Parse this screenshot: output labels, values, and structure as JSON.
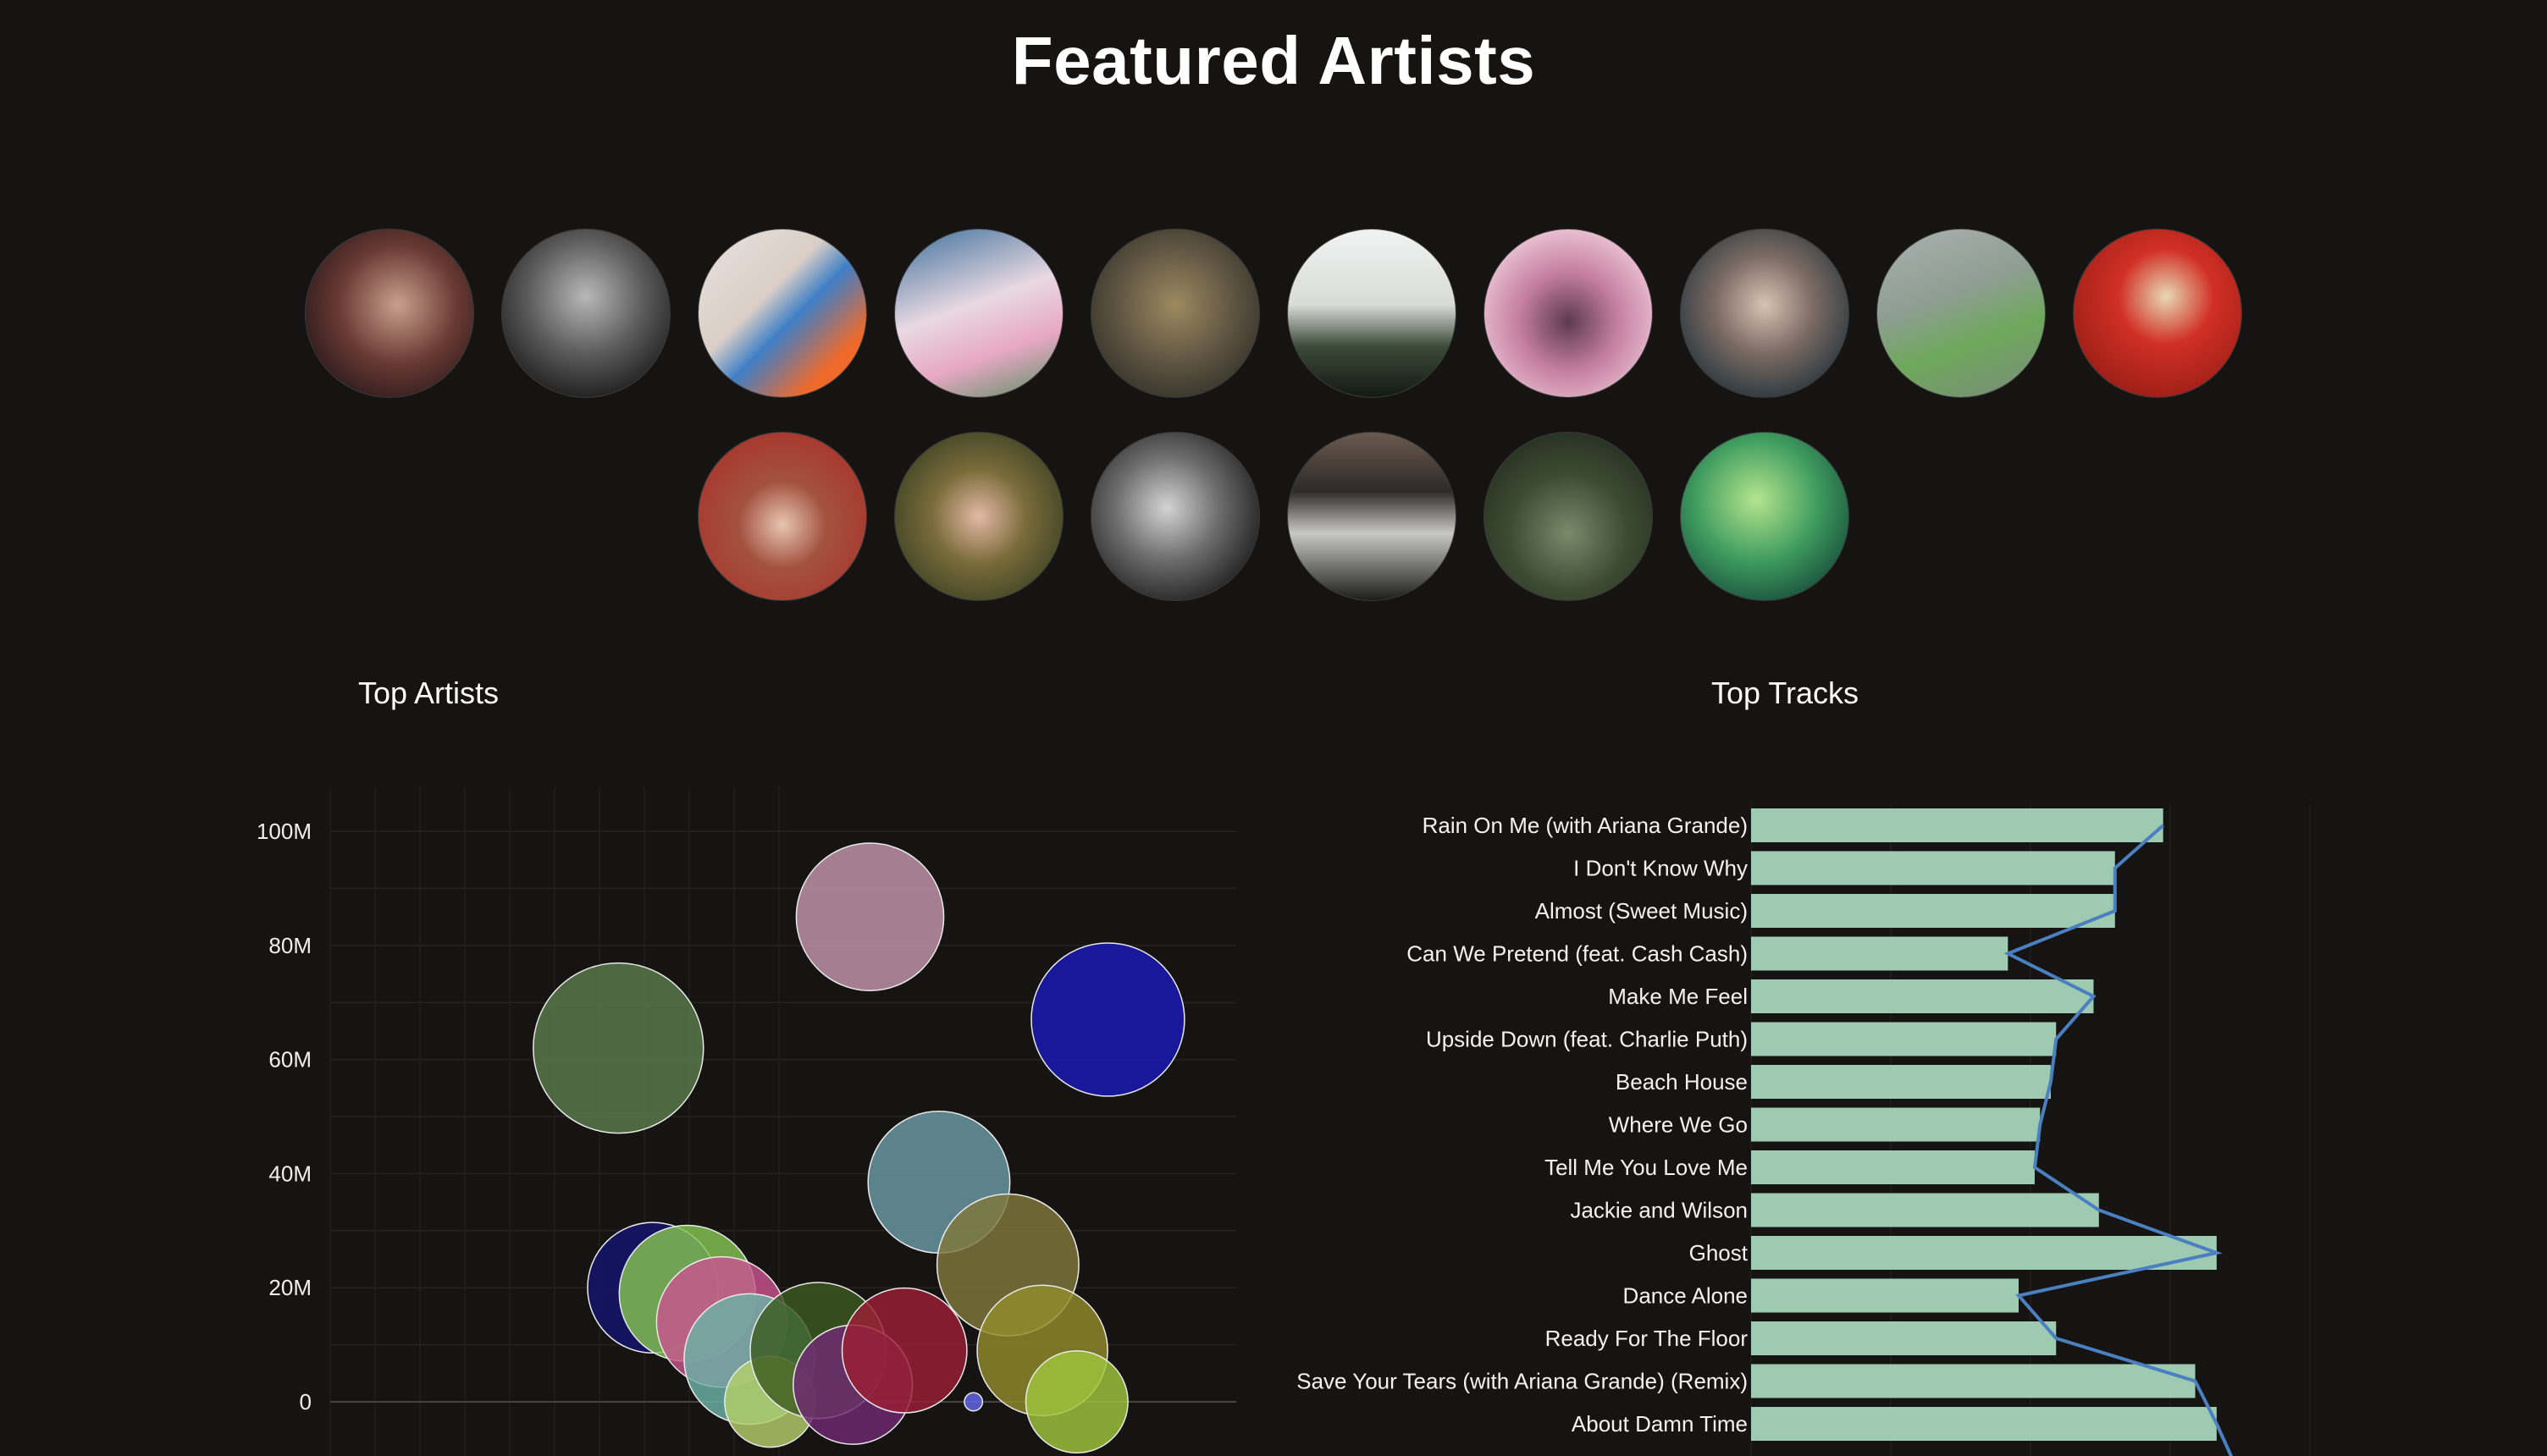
{
  "header": {
    "title": "Featured Artists"
  },
  "avatars": [
    {
      "name": "avatar-1",
      "bg": "radial-gradient(circle at 55% 45%, #c9a08e 0%, #6a3a33 45%, #2b1a1c 80%)"
    },
    {
      "name": "avatar-2",
      "bg": "radial-gradient(circle at 50% 40%, #b8b8b8 0%, #5a5a5a 45%, #161616 85%)"
    },
    {
      "name": "avatar-3",
      "bg": "linear-gradient(135deg, #e8e2dc 0%, #d9cfc7 40%, #3f7fc6 55%, #ef6a2a 80%)"
    },
    {
      "name": "avatar-4",
      "bg": "linear-gradient(160deg, #3c6f9c 0%, #e9d9e2 45%, #e8a9c6 70%, #5b8e61 100%)"
    },
    {
      "name": "avatar-5",
      "bg": "radial-gradient(circle at 50% 45%, #9e8a60 0%, #5a5140 50%, #2b2a22 90%)"
    },
    {
      "name": "avatar-6",
      "bg": "linear-gradient(180deg, #f1f2f2 0%, #d9dbd8 45%, #3b4a38 70%, #141a13 100%)"
    },
    {
      "name": "avatar-7",
      "bg": "radial-gradient(circle at 50% 55%, #5d3a4f 0%, #c57fa1 40%, #efc9da 80%)"
    },
    {
      "name": "avatar-8",
      "bg": "radial-gradient(circle at 50% 45%, #d8c2b5 0%, #7a6a62 40%, #1d2f3a 85%)"
    },
    {
      "name": "avatar-9",
      "bg": "linear-gradient(160deg, #aab0b2 0%, #8e9e92 40%, #6ea85b 65%, #7b8a7d 100%)"
    },
    {
      "name": "avatar-10",
      "bg": "radial-gradient(circle at 55% 40%, #e7d9b5 0%, #d12f24 35%, #8c1a13 90%)"
    },
    {
      "name": "avatar-11",
      "bg": "radial-gradient(circle at 50% 55%, #e7c6b0 0%, #a35240 35%, #a8352c 80%)"
    },
    {
      "name": "avatar-12",
      "bg": "radial-gradient(circle at 50% 50%, #e3b9a4 0%, #7a6b3a 40%, #2f3a1f 90%)"
    },
    {
      "name": "avatar-13",
      "bg": "radial-gradient(circle at 45% 45%, #d4d4d4 0%, #6d6d6d 40%, #121212 85%)"
    },
    {
      "name": "avatar-14",
      "bg": "linear-gradient(180deg, #6b5a4e 0%, #2d2a28 35%, #c8c8c4 60%, #1c1c1c 100%)"
    },
    {
      "name": "avatar-15",
      "bg": "radial-gradient(circle at 50% 60%, #7a8a6a 0%, #3d4b33 45%, #1f2a1b 90%)"
    },
    {
      "name": "avatar-16",
      "bg": "radial-gradient(circle at 45% 40%, #b5e58e 0%, #3f9c5f 45%, #0f3b34 90%)"
    }
  ],
  "charts": {
    "artists_title": "Top Artists",
    "tracks_title": "Top Tracks"
  },
  "chart_data": [
    {
      "type": "scatter",
      "title": "Top Artists",
      "y_ticks": [
        "0",
        "20M",
        "40M",
        "60M",
        "80M",
        "100M"
      ],
      "ylim": [
        -7000000,
        107000000
      ],
      "xlim": [
        0,
        21
      ],
      "grid": true,
      "series": [
        {
          "x": 10.5,
          "y": 85000000,
          "size": 13,
          "color": "#c497ad"
        },
        {
          "x": 3.2,
          "y": 62000000,
          "size": 15,
          "color": "#5a7d4c"
        },
        {
          "x": 17.4,
          "y": 67000000,
          "size": 13.5,
          "color": "#1a18b8"
        },
        {
          "x": 12.5,
          "y": 38500000,
          "size": 12.5,
          "color": "#6b9ba6"
        },
        {
          "x": 4.2,
          "y": 20000000,
          "size": 11.5,
          "color": "#14136e"
        },
        {
          "x": 5.2,
          "y": 19000000,
          "size": 12,
          "color": "#85c452"
        },
        {
          "x": 6.2,
          "y": 14000000,
          "size": 11.5,
          "color": "#c9538f"
        },
        {
          "x": 7.0,
          "y": 7500000,
          "size": 11.5,
          "color": "#6bb2a6"
        },
        {
          "x": 7.6,
          "y": 0,
          "size": 8,
          "color": "#b5d06a"
        },
        {
          "x": 9.0,
          "y": 9000000,
          "size": 12,
          "color": "#3c5a1f"
        },
        {
          "x": 10.0,
          "y": 3000000,
          "size": 10.5,
          "color": "#702a73"
        },
        {
          "x": 11.5,
          "y": 9000000,
          "size": 11,
          "color": "#9b1f34"
        },
        {
          "x": 14.5,
          "y": 24000000,
          "size": 12.5,
          "color": "#80783a"
        },
        {
          "x": 15.5,
          "y": 9000000,
          "size": 11.5,
          "color": "#918c2c"
        },
        {
          "x": 16.5,
          "y": 0,
          "size": 9,
          "color": "#9fc63c"
        },
        {
          "x": 13.5,
          "y": 0,
          "size": 1.6,
          "color": "#6666ee"
        }
      ]
    },
    {
      "type": "bar",
      "title": "Top Tracks",
      "orientation": "horizontal",
      "categories": [
        "Rain On Me (with Ariana Grande)",
        "I Don't Know Why",
        "Almost (Sweet Music)",
        "Can We Pretend (feat. Cash Cash)",
        "Make Me Feel",
        "Upside Down (feat. Charlie Puth)",
        "Beach House",
        "Where We Go",
        "Tell Me You Love Me",
        "Jackie and Wilson",
        "Ghost",
        "Dance Alone",
        "Ready For The Floor",
        "Save Your Tears (with Ariana Grande) (Remix)",
        "About Damn Time"
      ],
      "values": [
        77,
        68,
        68,
        48,
        64,
        57,
        56,
        54,
        53,
        65,
        87,
        50,
        57,
        83,
        87
      ],
      "line_values": [
        77,
        68,
        68,
        48,
        64,
        57,
        56,
        54,
        53,
        65,
        87,
        50,
        57,
        83,
        87
      ],
      "xlim": [
        0,
        110
      ],
      "bar_color": "#9ecab2",
      "line_color": "#4a7fc0"
    }
  ]
}
